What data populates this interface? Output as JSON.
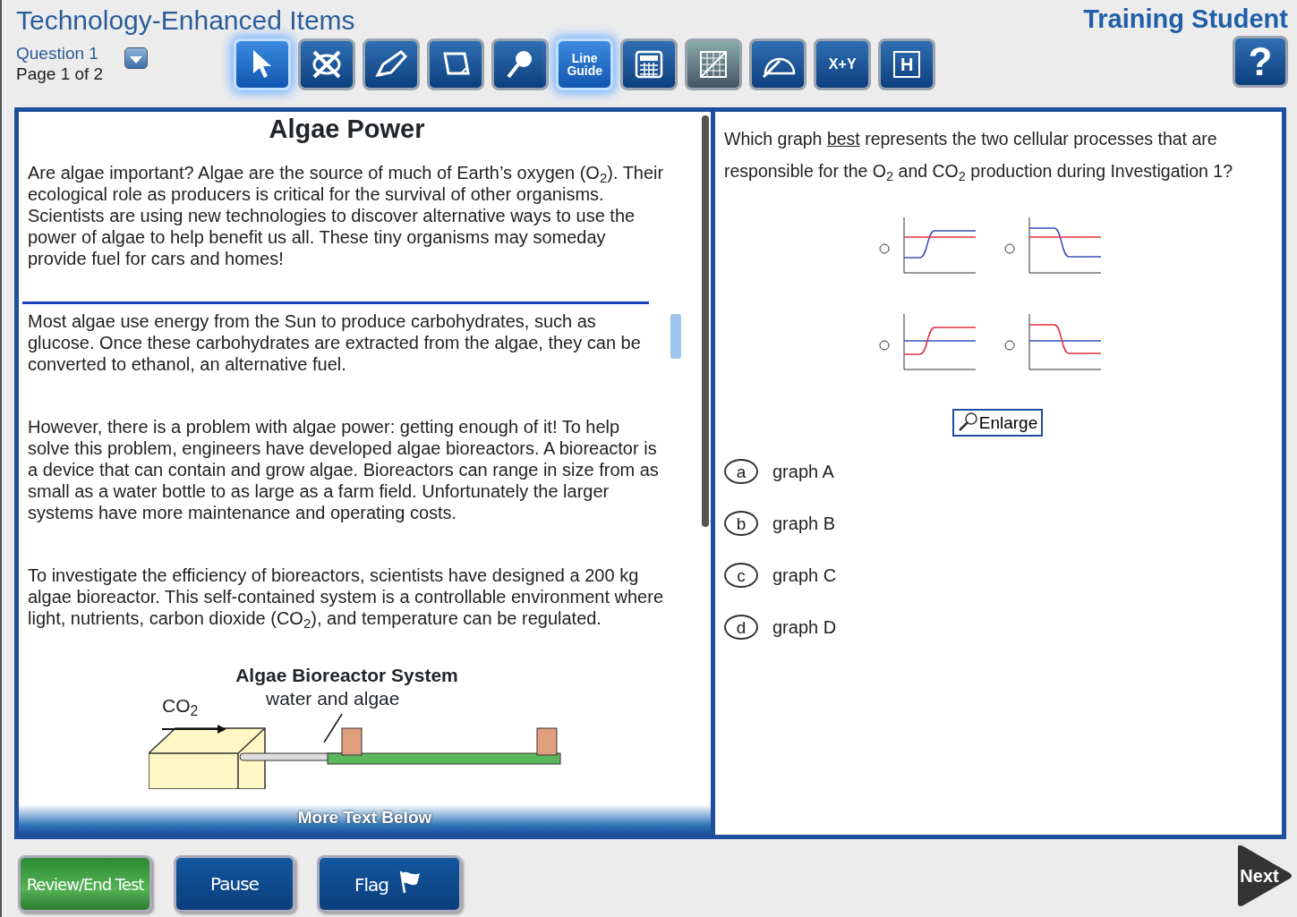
{
  "header": {
    "title": "Technology-Enhanced Items",
    "student": "Training Student",
    "question": "Question 1",
    "page": "Page 1 of 2"
  },
  "tools": [
    {
      "kind": "pointer",
      "selected": true
    },
    {
      "kind": "eliminator",
      "selected": false
    },
    {
      "kind": "highlighter",
      "selected": false
    },
    {
      "kind": "note",
      "selected": false
    },
    {
      "kind": "magnifier",
      "selected": false
    },
    {
      "kind": "lineguide",
      "label": "Line Guide",
      "selected": true
    },
    {
      "kind": "calculator",
      "selected": false
    },
    {
      "kind": "graph",
      "selected": false
    },
    {
      "kind": "protractor",
      "selected": false
    },
    {
      "kind": "formula",
      "label": "X+Y",
      "selected": false
    },
    {
      "kind": "reference",
      "label": "H",
      "selected": false
    }
  ],
  "help": "?",
  "passage": {
    "title": "Algae Power",
    "paragraphs": [
      "Are algae important? Algae are the source of much of Earth’s oxygen (O$_{2}$). Their ecological role as producers is critical for the survival of other organisms. Scientists are using new technologies to discover alternative ways to use the power of algae to help benefit us all. These tiny organisms may someday provide fuel for cars and homes!",
      "Most algae use energy from the Sun to produce carbohydrates, such as glucose. Once these carbohydrates are extracted from the algae, they can be converted to ethanol, an alternative fuel.",
      "However, there is a problem with algae power: getting enough of it! To help solve this problem, engineers have developed algae bioreactors. A bioreactor is a device that can contain and grow algae. Bioreactors can range in size from as small as a water bottle to as large as a farm field. Unfortunately the larger systems have more maintenance and operating costs.",
      "To investigate the efficiency of bioreactors, scientists have designed a 200 kg algae bioreactor. This self-contained system is a controllable environment where light, nutrients, carbon dioxide (CO$_{2}$), and temperature can be regulated."
    ],
    "figure": {
      "title": "Algae Bioreactor System",
      "gas_label": "CO$_{2}$",
      "tank_label": "water and algae"
    },
    "more": "More Text Below"
  },
  "question": {
    "segments": [
      {
        "text": "Which graph ",
        "underline": false
      },
      {
        "text": "best",
        "underline": true
      },
      {
        "text": " represents the two cellular processes that are responsible for the O$_{2}$ and CO$_{2}$ production during Investigation 1?",
        "underline": false
      }
    ],
    "enlarge": "Enlarge",
    "options": [
      {
        "letter": "a",
        "text": "graph A",
        "selected": false
      },
      {
        "letter": "b",
        "text": "graph B",
        "selected": false
      },
      {
        "letter": "c",
        "text": "graph C",
        "selected": false
      },
      {
        "letter": "d",
        "text": "graph D",
        "selected": false
      }
    ]
  },
  "footer": [
    {
      "kind": "review",
      "label": "Review/End Test"
    },
    {
      "kind": "pause",
      "label": "Pause"
    },
    {
      "kind": "flag",
      "label": "Flag"
    }
  ],
  "next": "Next"
}
